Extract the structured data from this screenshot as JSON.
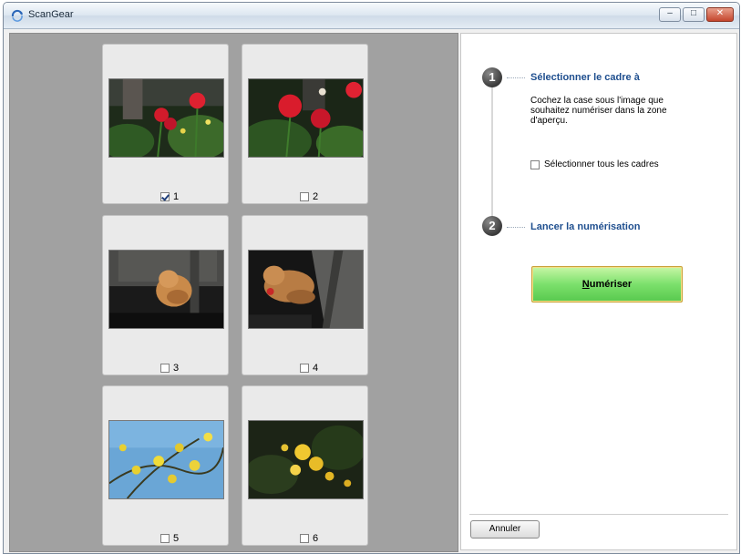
{
  "window": {
    "title": "ScanGear",
    "controls": {
      "minimize": "‒",
      "maximize": "□",
      "close": "✕"
    }
  },
  "preview": {
    "frames": [
      {
        "number": "1",
        "checked": true,
        "image": "red tulips"
      },
      {
        "number": "2",
        "checked": false,
        "image": "red tulips close-up"
      },
      {
        "number": "3",
        "checked": false,
        "image": "cat on fence"
      },
      {
        "number": "4",
        "checked": false,
        "image": "cat lying"
      },
      {
        "number": "5",
        "checked": false,
        "image": "yellow flowers blue sky"
      },
      {
        "number": "6",
        "checked": false,
        "image": "yellow flowers dark"
      }
    ]
  },
  "side": {
    "step1": {
      "number": "1",
      "title": "Sélectionner le cadre à",
      "description": "Cochez la case sous l'image que souhaitez numériser dans la zone d'aperçu.",
      "select_all_label": "Sélectionner tous les cadres",
      "select_all_checked": false
    },
    "step2": {
      "number": "2",
      "title": "Lancer la numérisation"
    },
    "scan_button": {
      "mnemonic": "N",
      "rest": "umériser"
    },
    "cancel_button": "Annuler"
  },
  "colors": {
    "accent_title": "#1f4f8f",
    "scan_button_green": "#7ce06c",
    "preview_background": "#a1a1a1"
  }
}
